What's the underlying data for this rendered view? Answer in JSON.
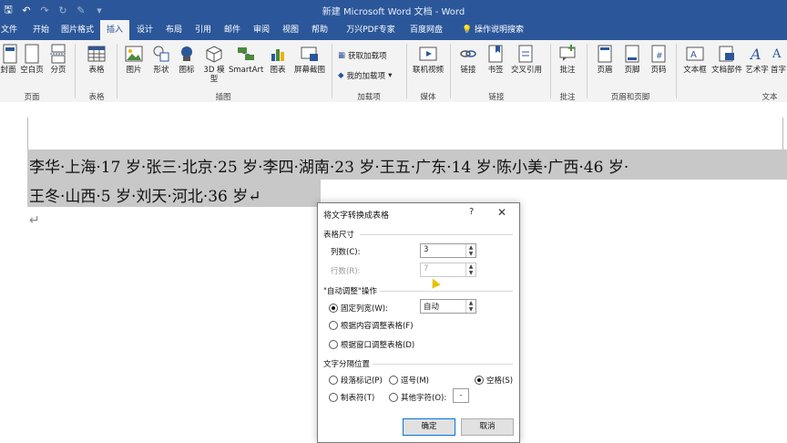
{
  "window": {
    "title": "新建 Microsoft Word 文档 - Word"
  },
  "qat": [
    "save-icon",
    "undo-icon",
    "redo-icon",
    "repeat-icon",
    "draw-icon",
    "more-icon"
  ],
  "tabs": [
    {
      "label": "文件"
    },
    {
      "label": "开始"
    },
    {
      "label": "图片格式"
    },
    {
      "label": "插入"
    },
    {
      "label": "设计"
    },
    {
      "label": "布局"
    },
    {
      "label": "引用"
    },
    {
      "label": "邮件"
    },
    {
      "label": "审阅"
    },
    {
      "label": "视图"
    },
    {
      "label": "帮助"
    },
    {
      "label": "万兴PDF专家"
    },
    {
      "label": "百度网盘"
    },
    {
      "label": "操作说明搜索"
    }
  ],
  "ribbon": {
    "pages": {
      "cover": "封面",
      "blank": "空白页",
      "break": "分页",
      "group": "页面"
    },
    "table": {
      "table": "表格",
      "group": "表格"
    },
    "illus": {
      "pic": "图片",
      "shape": "形状",
      "icon": "图标",
      "model": "3D 模型",
      "smartart": "SmartArt",
      "chart": "图表",
      "screenshot": "屏幕截图",
      "group": "插图"
    },
    "addins": {
      "get": "获取加载项",
      "mine": "我的加载项",
      "group": "加载项"
    },
    "media": {
      "video": "联机视频",
      "group": "媒体"
    },
    "links": {
      "link": "链接",
      "bookmark": "书签",
      "cross": "交叉引用",
      "group": "链接"
    },
    "comments": {
      "comment": "批注",
      "group": "批注"
    },
    "hf": {
      "header": "页眉",
      "footer": "页脚",
      "pagenum": "页码",
      "group": "页眉和页脚"
    },
    "text": {
      "textbox": "文本框",
      "parts": "文档部件",
      "wordart": "艺术字",
      "dropcap": "首字",
      "group": "文本"
    }
  },
  "document": {
    "line1": "李华·上海·17 岁·张三·北京·25 岁·李四·湖南·23 岁·王五·广东·14 岁·陈小美·广西·46 岁·",
    "line2": "王冬·山西·5 岁·刘天·河北·36 岁↵",
    "return_mark": "↵"
  },
  "dialog": {
    "title": "将文字转换成表格",
    "help": "?",
    "close": "✕",
    "size_section": "表格尺寸",
    "cols_label": "列数(C):",
    "cols_value": "3",
    "rows_label": "行数(R):",
    "rows_value": "7",
    "autofit_section": "\"自动调整\"操作",
    "fixed_label": "固定列宽(W):",
    "fixed_value": "自动",
    "content_label": "根据内容调整表格(F)",
    "window_label": "根据窗口调整表格(D)",
    "sep_section": "文字分隔位置",
    "para_label": "段落标记(P)",
    "comma_label": "逗号(M)",
    "space_label": "空格(S)",
    "tab_label": "制表符(T)",
    "other_label": "其他字符(O):",
    "other_value": "-",
    "ok": "确定",
    "cancel": "取消"
  },
  "colors": {
    "accent": "#2b579a",
    "highlight": "#c8c8c8"
  }
}
